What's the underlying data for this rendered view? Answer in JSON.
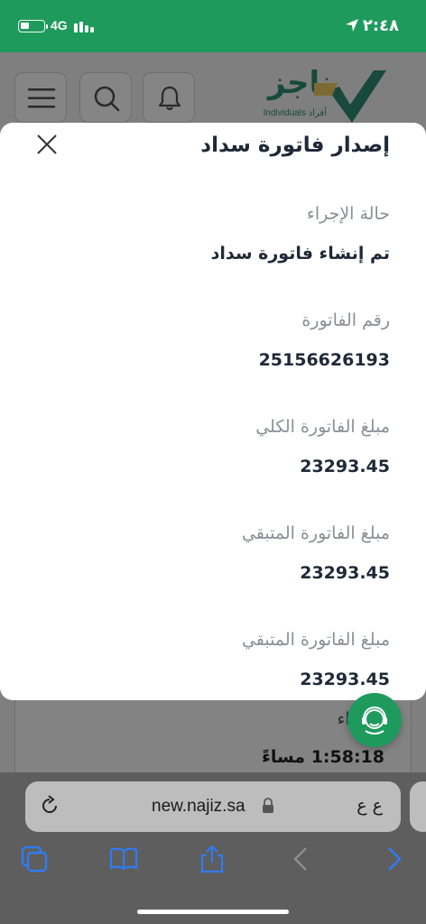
{
  "status_bar": {
    "time": "٢:٤٨",
    "network": "4G"
  },
  "header": {
    "logo_text": "ناجز",
    "logo_subtitle": "Individuals أفراد"
  },
  "modal": {
    "title": "إصدار فاتورة سداد",
    "fields": [
      {
        "label": "حالة الإجراء",
        "value": "تم إنشاء فاتورة سداد"
      },
      {
        "label": "رقم الفاتورة",
        "value": "25156626193"
      },
      {
        "label": "مبلغ الفاتورة الكلي",
        "value": "23293.45"
      },
      {
        "label": "مبلغ الفاتورة المتبقي",
        "value": "23293.45"
      },
      {
        "label": "مبلغ الفاتورة المتبقي",
        "value": "23293.45"
      }
    ]
  },
  "background_card": {
    "label": "الإجراء",
    "value": "1:58:18 مساءً"
  },
  "browser": {
    "url": "new.najiz.sa",
    "text_size_label": "ع ع"
  },
  "colors": {
    "brand_green": "#1f9a5d",
    "accent_gold": "#c9a227",
    "ios_blue": "#2f7cf6"
  },
  "icons": [
    "location-arrow-icon",
    "battery-icon",
    "signal-icon",
    "menu-icon",
    "search-icon",
    "bell-icon",
    "close-icon",
    "support-agent-icon",
    "reload-icon",
    "lock-icon",
    "tabs-icon",
    "bookmarks-icon",
    "share-icon",
    "back-icon",
    "forward-icon"
  ]
}
